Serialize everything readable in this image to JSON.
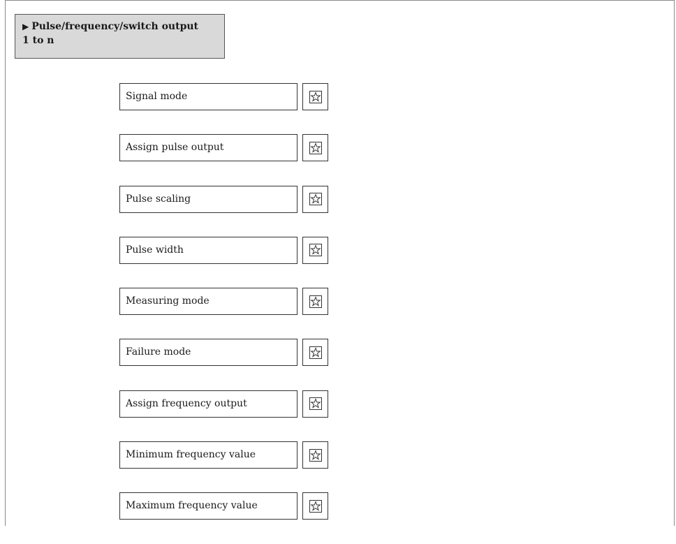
{
  "menu": {
    "arrow": "▶",
    "title_line1": "Pulse/frequency/switch output",
    "title_line2": "1 to n"
  },
  "parameters": [
    {
      "label": "Signal mode",
      "icon": "star-user-access-icon"
    },
    {
      "label": "Assign pulse output",
      "icon": "star-user-access-icon"
    },
    {
      "label": "Pulse scaling",
      "icon": "star-user-access-icon"
    },
    {
      "label": "Pulse width",
      "icon": "star-user-access-icon"
    },
    {
      "label": "Measuring mode",
      "icon": "star-user-access-icon"
    },
    {
      "label": "Failure mode",
      "icon": "star-user-access-icon"
    },
    {
      "label": "Assign frequency output",
      "icon": "star-user-access-icon"
    },
    {
      "label": "Minimum frequency value",
      "icon": "star-user-access-icon"
    },
    {
      "label": "Maximum frequency value",
      "icon": "star-user-access-icon"
    }
  ]
}
